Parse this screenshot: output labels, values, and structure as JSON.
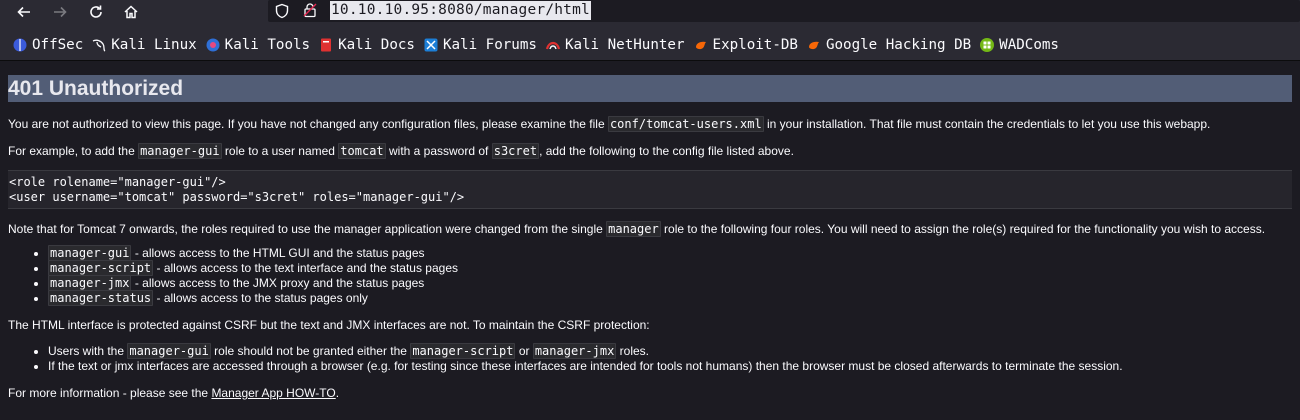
{
  "browser": {
    "url": "10.10.10.95:8080/manager/html",
    "bookmarks": [
      {
        "label": "OffSec",
        "icon": "offsec-icon"
      },
      {
        "label": "Kali Linux",
        "icon": "kali-dragon-icon"
      },
      {
        "label": "Kali Tools",
        "icon": "kali-tools-icon"
      },
      {
        "label": "Kali Docs",
        "icon": "kali-docs-icon"
      },
      {
        "label": "Kali Forums",
        "icon": "kali-forums-icon"
      },
      {
        "label": "Kali NetHunter",
        "icon": "nethunter-icon"
      },
      {
        "label": "Exploit-DB",
        "icon": "exploit-db-icon"
      },
      {
        "label": "Google Hacking DB",
        "icon": "ghdb-icon"
      },
      {
        "label": "WADComs",
        "icon": "wadcoms-icon"
      }
    ]
  },
  "page": {
    "title": "401 Unauthorized",
    "p1": {
      "a": "You are not authorized to view this page. If you have not changed any configuration files, please examine the file ",
      "code": "conf/tomcat-users.xml",
      "b": " in your installation. That file must contain the credentials to let you use this webapp."
    },
    "p2": {
      "a": "For example, to add the ",
      "code1": "manager-gui",
      "b": " role to a user named ",
      "code2": "tomcat",
      "c": " with a password of ",
      "code3": "s3cret",
      "d": ", add the following to the config file listed above."
    },
    "config_code": "<role rolename=\"manager-gui\"/>\n<user username=\"tomcat\" password=\"s3cret\" roles=\"manager-gui\"/>",
    "p3": {
      "a": "Note that for Tomcat 7 onwards, the roles required to use the manager application were changed from the single ",
      "code": "manager",
      "b": " role to the following four roles. You will need to assign the role(s) required for the functionality you wish to access."
    },
    "roles": [
      {
        "code": "manager-gui",
        "text": " - allows access to the HTML GUI and the status pages"
      },
      {
        "code": "manager-script",
        "text": " - allows access to the text interface and the status pages"
      },
      {
        "code": "manager-jmx",
        "text": " - allows access to the JMX proxy and the status pages"
      },
      {
        "code": "manager-status",
        "text": " - allows access to the status pages only"
      }
    ],
    "p4": "The HTML interface is protected against CSRF but the text and JMX interfaces are not. To maintain the CSRF protection:",
    "csrf_item1": {
      "a": "Users with the ",
      "code1": "manager-gui",
      "b": " role should not be granted either the ",
      "code2": "manager-script",
      "c": " or ",
      "code3": "manager-jmx",
      "d": " roles."
    },
    "csrf_item2": "If the text or jmx interfaces are accessed through a browser (e.g. for testing since these interfaces are intended for tools not humans) then the browser must be closed afterwards to terminate the session.",
    "p5": {
      "a": "For more information - please see the ",
      "link": "Manager App HOW-TO",
      "b": "."
    }
  }
}
